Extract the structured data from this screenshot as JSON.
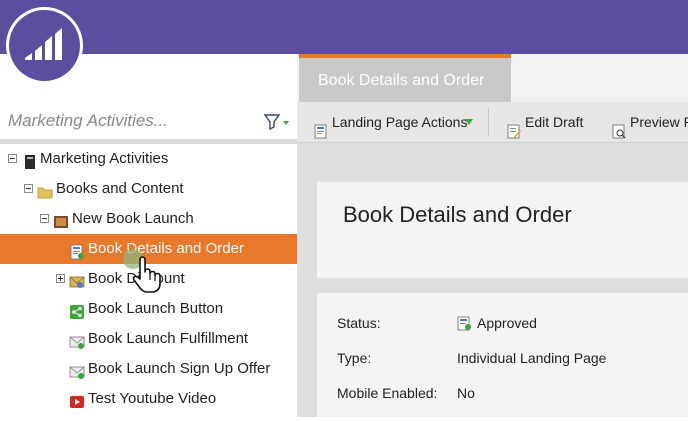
{
  "app": {
    "logo_icon": "marketo-logo-icon",
    "brand_color": "#5c4e9e",
    "accent_color": "#e8792a"
  },
  "sidebar": {
    "search_placeholder": "Marketing Activities...",
    "filter_icon": "filter-funnel-icon",
    "tree": [
      {
        "label": "Marketing Activities",
        "icon": "marketing-activities-icon",
        "expander": "minus"
      },
      {
        "label": "Books and Content",
        "icon": "folder-icon",
        "expander": "minus"
      },
      {
        "label": "New Book Launch",
        "icon": "program-icon",
        "expander": "minus"
      },
      {
        "label": "Book Details and Order",
        "icon": "landing-page-icon",
        "selected": true
      },
      {
        "label": "Book Discount",
        "icon": "email-program-icon",
        "expander": "plus"
      },
      {
        "label": "Book Launch Button",
        "icon": "social-share-icon"
      },
      {
        "label": "Book Launch Fulfillment",
        "icon": "email-icon"
      },
      {
        "label": "Book Launch Sign Up Offer",
        "icon": "email-icon"
      },
      {
        "label": "Test Youtube Video",
        "icon": "youtube-icon"
      }
    ]
  },
  "main": {
    "active_tab": "Book Details and Order",
    "toolbar": {
      "landing_page_actions": "Landing Page Actions",
      "edit_draft": "Edit Draft",
      "preview": "Preview P"
    },
    "page_title": "Book Details and Order",
    "details": {
      "status_label": "Status:",
      "status_value": "Approved",
      "type_label": "Type:",
      "type_value": "Individual Landing Page",
      "mobile_label": "Mobile Enabled:",
      "mobile_value": "No"
    }
  }
}
